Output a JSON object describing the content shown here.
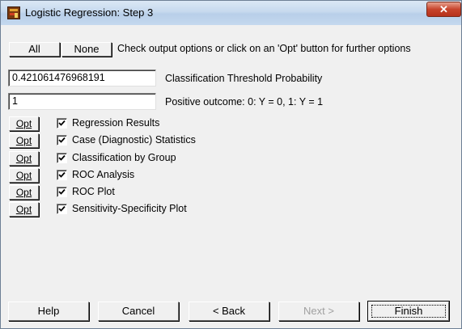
{
  "window": {
    "title": "Logistic Regression: Step 3",
    "close_glyph": "✕"
  },
  "selection": {
    "all_label": "All",
    "none_label": "None",
    "hint": "Check output options or click on an 'Opt' button for further options"
  },
  "threshold": {
    "value": "0.421061476968191",
    "label": "Classification Threshold Probability"
  },
  "positive": {
    "value": "1",
    "label": "Positive outcome: 0: Y = 0, 1: Y = 1"
  },
  "options": [
    {
      "opt_label": "Opt",
      "label": "Regression Results",
      "checked": true
    },
    {
      "opt_label": "Opt",
      "label": "Case (Diagnostic) Statistics",
      "checked": true
    },
    {
      "opt_label": "Opt",
      "label": "Classification by Group",
      "checked": true
    },
    {
      "opt_label": "Opt",
      "label": "ROC Analysis",
      "checked": true
    },
    {
      "opt_label": "Opt",
      "label": "ROC Plot",
      "checked": true
    },
    {
      "opt_label": "Opt",
      "label": "Sensitivity-Specificity Plot",
      "checked": true
    }
  ],
  "footer": {
    "help_label": "Help",
    "cancel_label": "Cancel",
    "back_label": "< Back",
    "next_label": "Next >",
    "finish_label": "Finish"
  }
}
